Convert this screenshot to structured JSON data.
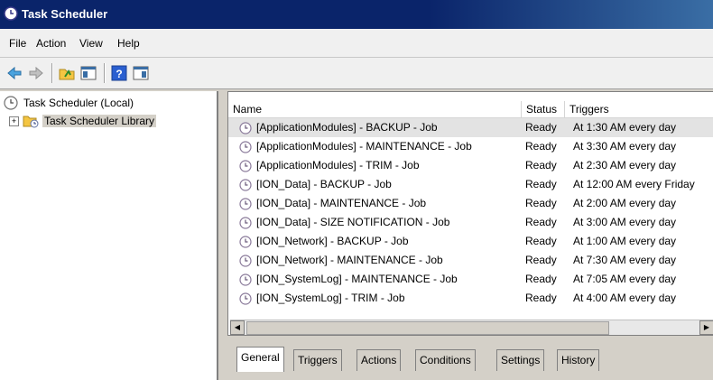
{
  "window": {
    "title": "Task Scheduler"
  },
  "menu": [
    "File",
    "Action",
    "View",
    "Help"
  ],
  "tree": {
    "root": "Task Scheduler (Local)",
    "library": "Task Scheduler Library"
  },
  "table": {
    "columns": [
      "Name",
      "Status",
      "Triggers"
    ],
    "rows": [
      {
        "name": "[ApplicationModules] - BACKUP - Job",
        "status": "Ready",
        "trigger": "At 1:30 AM every day"
      },
      {
        "name": "[ApplicationModules] - MAINTENANCE - Job",
        "status": "Ready",
        "trigger": "At 3:30 AM every day"
      },
      {
        "name": "[ApplicationModules] - TRIM - Job",
        "status": "Ready",
        "trigger": "At 2:30 AM every day"
      },
      {
        "name": "[ION_Data] - BACKUP - Job",
        "status": "Ready",
        "trigger": "At 12:00 AM every Friday"
      },
      {
        "name": "[ION_Data] - MAINTENANCE - Job",
        "status": "Ready",
        "trigger": "At 2:00 AM every day"
      },
      {
        "name": "[ION_Data] - SIZE NOTIFICATION - Job",
        "status": "Ready",
        "trigger": "At 3:00 AM every day"
      },
      {
        "name": "[ION_Network] - BACKUP - Job",
        "status": "Ready",
        "trigger": "At 1:00 AM every day"
      },
      {
        "name": "[ION_Network] - MAINTENANCE - Job",
        "status": "Ready",
        "trigger": "At 7:30 AM every day"
      },
      {
        "name": "[ION_SystemLog] - MAINTENANCE - Job",
        "status": "Ready",
        "trigger": "At 7:05 AM every day"
      },
      {
        "name": "[ION_SystemLog] - TRIM - Job",
        "status": "Ready",
        "trigger": "At 4:00 AM every day"
      }
    ]
  },
  "tabs": [
    "General",
    "Triggers",
    "Actions",
    "Conditions",
    "Settings",
    "History"
  ],
  "icons": {
    "title": "clock-icon",
    "toolbar": [
      "back-arrow-icon",
      "forward-arrow-icon",
      "up-folder-icon",
      "show-hide-console-tree-icon",
      "help-icon",
      "show-hide-action-pane-icon"
    ],
    "tree_root": "clock-icon",
    "tree_library": "folder-clock-icon",
    "task_row": "clock-icon"
  },
  "colors": {
    "titlebar": "#0a246a",
    "selection": "#e3e3e3"
  }
}
